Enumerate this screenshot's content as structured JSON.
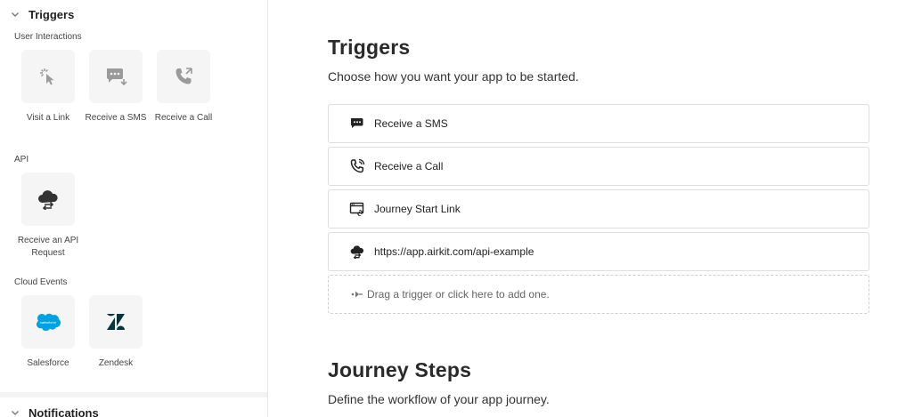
{
  "sidebar": {
    "triggers_title": "Triggers",
    "user_interactions_label": "User Interactions",
    "user_interactions": [
      {
        "label": "Visit a Link",
        "icon": "cursor-click-icon"
      },
      {
        "label": "Receive a SMS",
        "icon": "chat-bubble-icon"
      },
      {
        "label": "Receive a Call",
        "icon": "phone-icon"
      }
    ],
    "api_label": "API",
    "api_items": [
      {
        "label": "Receive an API Request",
        "icon": "cloud-sync-icon"
      }
    ],
    "cloud_events_label": "Cloud Events",
    "cloud_events": [
      {
        "label": "Salesforce",
        "icon": "salesforce-logo-icon"
      },
      {
        "label": "Zendesk",
        "icon": "zendesk-logo-icon"
      }
    ],
    "notifications_title": "Notifications"
  },
  "main": {
    "triggers_heading": "Triggers",
    "triggers_subtitle": "Choose how you want your app to be started.",
    "trigger_rows": [
      {
        "label": "Receive a SMS",
        "icon": "chat-bubble-icon"
      },
      {
        "label": "Receive a Call",
        "icon": "phone-ringing-icon"
      },
      {
        "label": "Journey Start Link",
        "icon": "browser-link-icon"
      },
      {
        "label": "https://app.airkit.com/api-example",
        "icon": "cloud-sync-icon"
      }
    ],
    "drop_zone_label": "Drag a trigger or click here to add one.",
    "journey_heading": "Journey Steps",
    "journey_subtitle": "Define the workflow of your app journey."
  },
  "colors": {
    "tile_bg": "#f5f5f5",
    "salesforce": "#00a1e0",
    "zendesk": "#03363d",
    "icon_grey": "#9a9a9a",
    "icon_dark": "#333333"
  }
}
